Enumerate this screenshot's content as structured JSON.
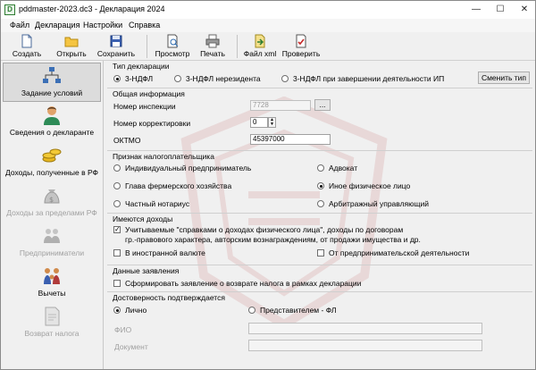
{
  "window": {
    "title": "pddmaster-2023.dc3 - Декларация 2024",
    "app_icon_letter": "D",
    "minimize": "—",
    "maximize": "☐",
    "close": "✕"
  },
  "menu": [
    "Файл",
    "Декларация",
    "Настройки",
    "Справка"
  ],
  "toolbar": [
    {
      "label": "Создать",
      "icon": "new-document-icon"
    },
    {
      "label": "Открыть",
      "icon": "open-folder-icon"
    },
    {
      "label": "Сохранить",
      "icon": "save-disk-icon"
    },
    {
      "label": "Просмотр",
      "icon": "preview-icon"
    },
    {
      "label": "Печать",
      "icon": "printer-icon"
    },
    {
      "label": "Файл xml",
      "icon": "xml-file-icon"
    },
    {
      "label": "Проверить",
      "icon": "check-document-icon"
    }
  ],
  "sidebar": [
    {
      "label": "Задание условий",
      "icon": "conditions-icon",
      "active": true
    },
    {
      "label": "Сведения о декларанте",
      "icon": "person-icon"
    },
    {
      "label": "Доходы, полученные в РФ",
      "icon": "coins-icon"
    },
    {
      "label": "Доходы за пределами РФ",
      "icon": "money-bag-icon",
      "disabled": true
    },
    {
      "label": "Предприниматели",
      "icon": "businessmen-icon",
      "disabled": true
    },
    {
      "label": "Вычеты",
      "icon": "family-icon"
    },
    {
      "label": "Возврат налога",
      "icon": "refund-document-icon",
      "disabled": true
    }
  ],
  "tip_deklaracii": {
    "title": "Тип декларации",
    "options": [
      "3-НДФЛ",
      "3-НДФЛ нерезидента",
      "3-НДФЛ при завершении деятельности ИП"
    ],
    "selected": 0,
    "change_button": "Сменить тип"
  },
  "obshaya_info": {
    "title": "Общая информация",
    "inspection_label": "Номер инспекции",
    "inspection_value": "7728",
    "inspection_button": "...",
    "correction_label": "Номер корректировки",
    "correction_value": "0",
    "oktmo_label": "ОКТМО",
    "oktmo_value": "45397000"
  },
  "priznak": {
    "title": "Признак налогоплательщика",
    "options": [
      "Индивидуальный предприниматель",
      "Адвокат",
      "Глава фермерского хозяйства",
      "Иное физическое лицо",
      "Частный нотариус",
      "Арбитражный управляющий"
    ],
    "selected": 3
  },
  "dohody": {
    "title": "Имеются доходы",
    "main_check_line1": "Учитываемые \"справками о доходах физического лица\", доходы по договорам",
    "main_check_line2": "гр.-правового характера, авторским вознаграждениям, от продажи имущества и др.",
    "main_checked": true,
    "foreign_label": "В иностранной валюте",
    "business_label": "От предпринимательской деятельности"
  },
  "zayavleniya": {
    "title": "Данные заявления",
    "check_label": "Сформировать заявление о возврате налога в рамках декларации"
  },
  "dostovernost": {
    "title": "Достоверность подтверждается",
    "options": [
      "Лично",
      "Представителем - ФЛ"
    ],
    "selected": 0,
    "fio_label": "ФИО",
    "document_label": "Документ"
  },
  "colors": {
    "accent": "#2f7d32",
    "watermark": "#b03030"
  }
}
